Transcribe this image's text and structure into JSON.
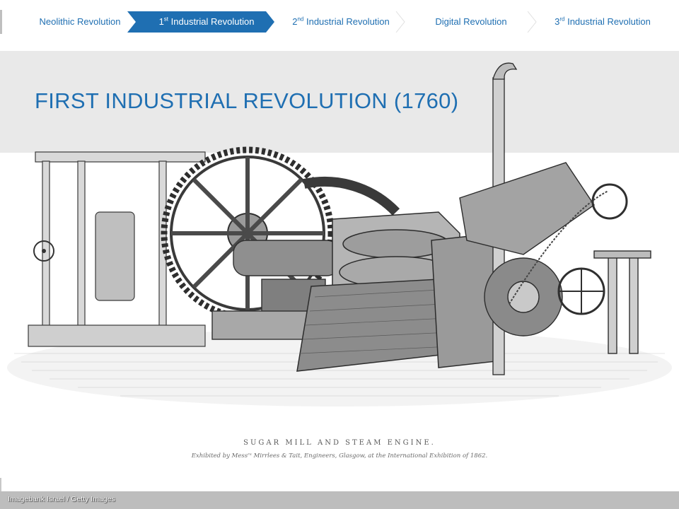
{
  "nav": {
    "steps": [
      {
        "label": "Neolithic Revolution",
        "prefix": "",
        "sup": "",
        "rest": "Neolithic Revolution",
        "active": false
      },
      {
        "prefix": "1",
        "sup": "st",
        "rest": " Industrial Revolution",
        "active": true
      },
      {
        "prefix": "2",
        "sup": "nd",
        "rest": " Industrial Revolution",
        "active": false
      },
      {
        "prefix": "",
        "sup": "",
        "rest": "Digital Revolution",
        "active": false
      },
      {
        "prefix": "3",
        "sup": "rd",
        "rest": " Industrial Revolution",
        "active": false
      }
    ],
    "active_color": "#1f6fb2",
    "text_color": "#1f6fb2"
  },
  "slide": {
    "title": "FIRST INDUSTRIAL REVOLUTION (1760)"
  },
  "illustration": {
    "caption_title": "SUGAR MILL AND STEAM ENGINE.",
    "caption_sub": "Exhibited by Messʳˢ Mirrlees & Tait, Engineers, Glasgow, at the International Exhibition of 1862."
  },
  "footer": {
    "credit": "Imagebank Israel / Getty Images"
  }
}
